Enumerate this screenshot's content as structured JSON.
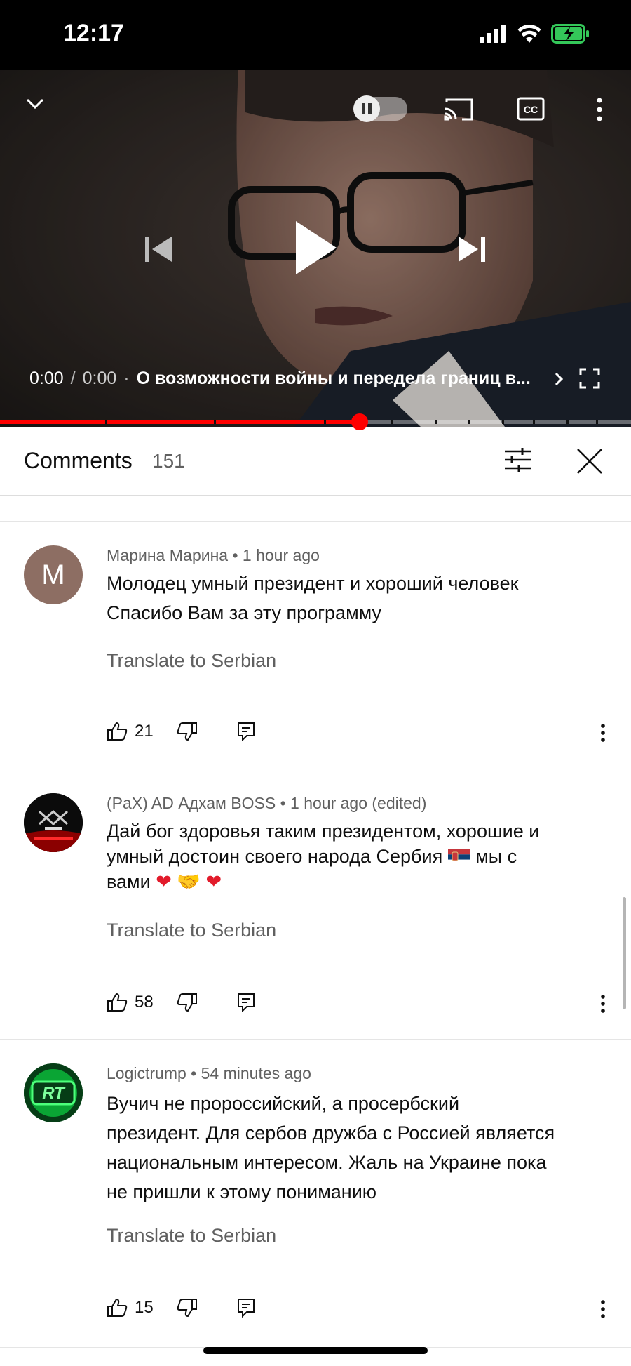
{
  "status_bar": {
    "time": "12:17",
    "battery_color": "#34c759"
  },
  "player": {
    "current_time": "0:00",
    "duration": "0:00",
    "title": "О возможности войны и передела границ в...",
    "progress_fraction": 0.0,
    "scrubber_fraction": 0.57,
    "autoplay": "off",
    "icons": [
      "chevron-down-icon",
      "autoplay-toggle-icon",
      "cast-icon",
      "captions-icon",
      "more-icon",
      "previous-icon",
      "play-icon",
      "next-icon",
      "chevron-right-icon",
      "fullscreen-icon"
    ]
  },
  "comments_header": {
    "title": "Comments",
    "count": "151",
    "sort_icon": "filter-sliders-icon",
    "close_icon": "close-icon"
  },
  "comments": [
    {
      "author": "Марина Марина",
      "time": "1 hour ago",
      "avatar_letter": "M",
      "avatar_color": "#8d6e63",
      "line1": "Молодец умный президент и хороший человек",
      "line2": "Спасибо Вам за эту программу",
      "translate": "Translate to Serbian",
      "likes": "21"
    },
    {
      "author": "(PaX)  AD Адхам BOSS",
      "time": "1 hour ago (edited)",
      "line1": "Дай бог здоровья таким президентом, хорошие и",
      "line2a": "умный достоин своего народа Сербия ",
      "line2b": " мы с",
      "line3": "вами ",
      "emoji_heart": "❤",
      "emoji_hands": "🤝",
      "translate": "Translate to Serbian",
      "likes": "58"
    },
    {
      "author": "Logictrump",
      "time": "54 minutes ago",
      "avatar_text": "RT",
      "avatar_color": "#0d8a2e",
      "line1": "Вучич не пророссийский, а просербский",
      "line2": "президент. Для сербов дружба с Россией является",
      "line3": "национальным интересом. Жаль на Украине пока",
      "line4": "не пришли к этому пониманию",
      "translate": "Translate to Serbian",
      "likes": "15"
    }
  ],
  "colors": {
    "accent": "#ff0000",
    "secondary_text": "#606060",
    "primary_text": "#0f0f0f"
  }
}
